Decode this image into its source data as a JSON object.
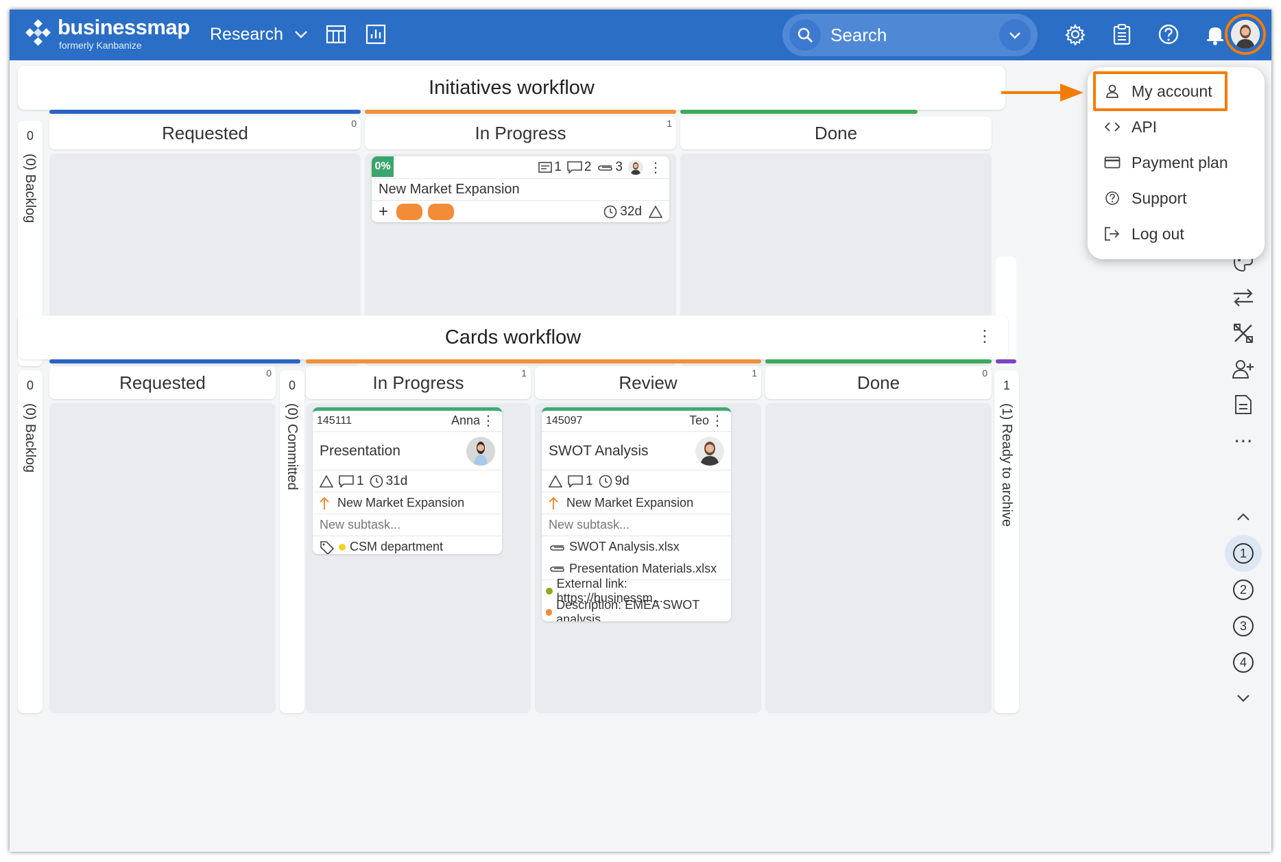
{
  "topbar": {
    "logo": "businessmap",
    "logo_sub": "formerly Kanbanize",
    "workspace": "Research",
    "search_placeholder": "Search"
  },
  "account_menu": {
    "items": [
      {
        "label": "My account",
        "icon": "user-icon"
      },
      {
        "label": "API",
        "icon": "code-icon"
      },
      {
        "label": "Payment plan",
        "icon": "credit-card-icon"
      },
      {
        "label": "Support",
        "icon": "question-icon"
      },
      {
        "label": "Log out",
        "icon": "logout-icon"
      }
    ]
  },
  "initiatives": {
    "title": "Initiatives workflow",
    "backlog_label": "(0) Backlog",
    "backlog_count": "0",
    "columns": [
      {
        "name": "Requested",
        "count": "0",
        "color": "#2a63c3"
      },
      {
        "name": "In Progress",
        "count": "1",
        "color": "#f2913d"
      },
      {
        "name": "Done",
        "count": "",
        "color": "#3faa57"
      }
    ],
    "card": {
      "progress": "0%",
      "subtasks": "1",
      "comments": "2",
      "attachments": "3",
      "title": "New Market Expansion",
      "age": "32d",
      "add_symbol": "+"
    }
  },
  "cards": {
    "title": "Cards workflow",
    "backlog_label": "(0) Backlog",
    "backlog_count": "0",
    "committed_label": "(0) Committed",
    "committed_count": "0",
    "archive_label": "(1) Ready to archive",
    "archive_count": "1",
    "columns": [
      {
        "name": "Requested",
        "count": "0",
        "color": "#2a63c3"
      },
      {
        "name": "In Progress",
        "count": "1",
        "color": "#f2913d"
      },
      {
        "name": "Review",
        "count": "1",
        "color": "#f2913d"
      },
      {
        "name": "Done",
        "count": "0",
        "color": "#3faa57"
      }
    ],
    "card1": {
      "id": "145111",
      "owner": "Anna",
      "title": "Presentation",
      "comments": "1",
      "age": "31d",
      "parent": "New Market Expansion",
      "subtask_placeholder": "New subtask...",
      "tag": "CSM department",
      "accent": "#3faa73"
    },
    "card2": {
      "id": "145097",
      "owner": "Teo",
      "title": "SWOT Analysis",
      "comments": "1",
      "age": "9d",
      "parent": "New Market Expansion",
      "subtask_placeholder": "New subtask...",
      "file1": "SWOT Analysis.xlsx",
      "file2": "Presentation Materials.xlsx",
      "field1": "External link: https://businessm...",
      "field2": "Description: EMEA SWOT analysis",
      "accent": "#3faa73"
    }
  },
  "rail": {
    "levels": [
      "1",
      "2",
      "3",
      "4"
    ],
    "more": "⋯"
  },
  "colors": {
    "topbar": "#2a6ec6",
    "highlight": "#f57c00"
  }
}
